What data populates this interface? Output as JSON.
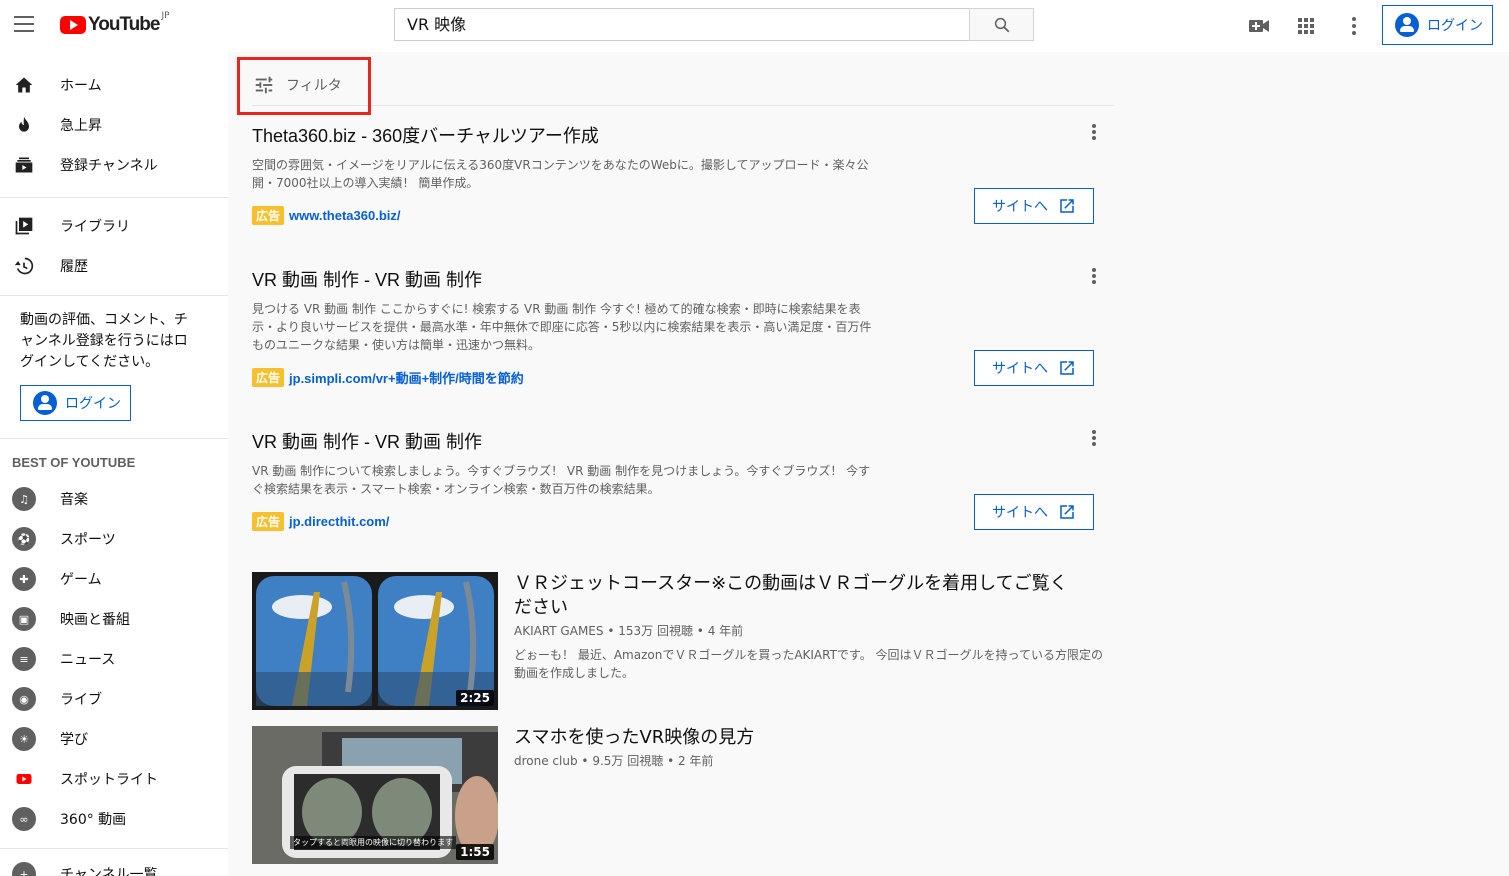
{
  "header": {
    "logo_text": "YouTube",
    "logo_region": "JP",
    "search_query": "VR 映像",
    "login_label": "ログイン"
  },
  "sidebar": {
    "main_items": [
      {
        "label": "ホーム",
        "icon": "home-icon"
      },
      {
        "label": "急上昇",
        "icon": "trending-icon"
      },
      {
        "label": "登録チャンネル",
        "icon": "subscriptions-icon"
      }
    ],
    "library_items": [
      {
        "label": "ライブラリ",
        "icon": "library-icon"
      },
      {
        "label": "履歴",
        "icon": "history-icon"
      }
    ],
    "promo_text": "動画の評価、コメント、チャンネル登録を行うにはログインしてください。",
    "login_label": "ログイン",
    "best_heading": "BEST OF YOUTUBE",
    "best_items": [
      {
        "label": "音楽",
        "icon": "music-icon"
      },
      {
        "label": "スポーツ",
        "icon": "sports-icon"
      },
      {
        "label": "ゲーム",
        "icon": "gaming-icon"
      },
      {
        "label": "映画と番組",
        "icon": "movies-icon"
      },
      {
        "label": "ニュース",
        "icon": "news-icon"
      },
      {
        "label": "ライブ",
        "icon": "live-icon"
      },
      {
        "label": "学び",
        "icon": "learning-icon"
      },
      {
        "label": "スポットライト",
        "icon": "spotlight-icon"
      },
      {
        "label": "360° 動画",
        "icon": "360-video-icon"
      }
    ],
    "partial_item": {
      "label": "チャンネル一覧",
      "icon": "add-channel-icon"
    }
  },
  "filter": {
    "label": "フィルタ"
  },
  "ads": [
    {
      "title": "Theta360.biz - 360度バーチャルツアー作成",
      "description": "空間の雰囲気・イメージをリアルに伝える360度VRコンテンツをあなたのWebに。撮影してアップロード・楽々公開・7000社以上の導入実績！ 簡単作成。",
      "badge": "広告",
      "url": "www.theta360.biz/",
      "button": "サイトへ"
    },
    {
      "title": "VR 動画 制作 - VR 動画 制作",
      "description": "見つける VR 動画 制作 ここからすぐに! 検索する VR 動画 制作 今すぐ! 極めて的確な検索・即時に検索結果を表示・より良いサービスを提供・最高水準・年中無休で即座に応答・5秒以内に検索結果を表示・高い満足度・百万件ものユニークな結果・使い方は簡単・迅速かつ無料。",
      "badge": "広告",
      "url": "jp.simpli.com/vr+動画+制作/時間を節約",
      "button": "サイトへ"
    },
    {
      "title": "VR 動画 制作 - VR 動画 制作",
      "description": "VR 動画 制作について検索しましょう。今すぐブラウズ！ VR 動画 制作を見つけましょう。今すぐブラウズ！ 今すぐ検索結果を表示・スマート検索・オンライン検索・数百万件の検索結果。",
      "badge": "広告",
      "url": "jp.directhit.com/",
      "button": "サイトへ"
    }
  ],
  "videos": [
    {
      "title": "ＶＲジェットコースター※この動画はＶＲゴーグルを着用してご覧ください",
      "channel": "AKIART GAMES",
      "views": "153万 回視聴",
      "age": "4 年前",
      "description": "どぉーも！ 最近、AmazonでＶＲゴーグルを買ったAKIARTです。 今回はＶＲゴーグルを持っている方限定の動画を作成しました。",
      "duration": "2:25"
    },
    {
      "title": "スマホを使ったVR映像の見方",
      "channel": "drone club",
      "views": "9.5万 回視聴",
      "age": "2 年前",
      "duration": "1:55",
      "thumb_caption": "タップすると両眼用の映像に切り替わります"
    }
  ],
  "colors": {
    "brand_red": "#ff0000",
    "link_blue": "#065fd4",
    "ad_badge": "#f9c02d",
    "highlight_box": "#e8271a"
  }
}
